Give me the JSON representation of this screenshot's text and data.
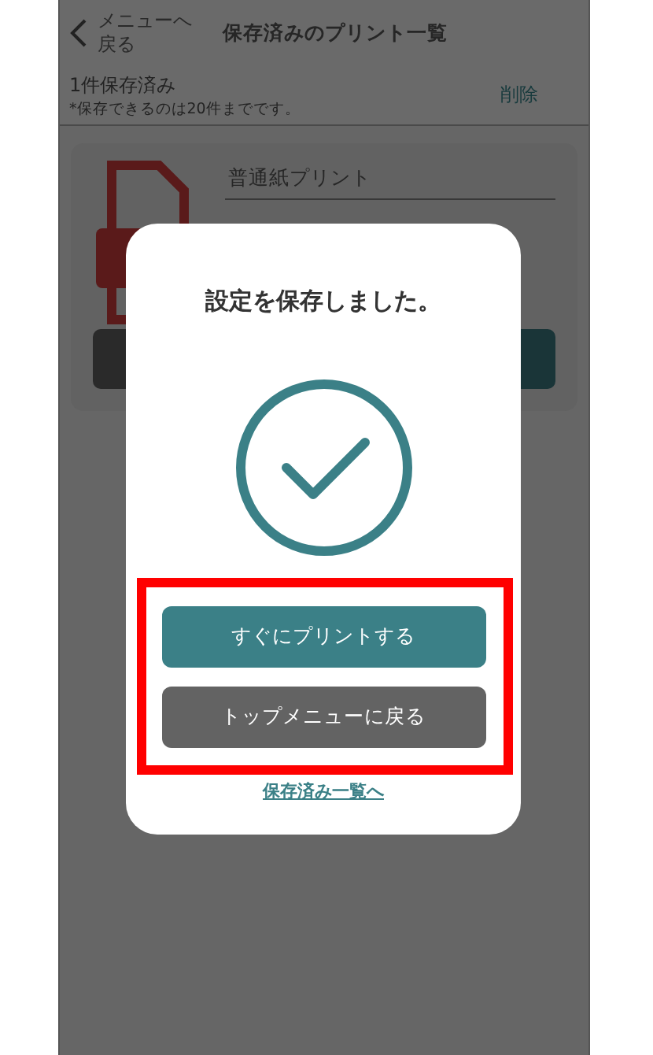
{
  "header": {
    "back_label": "メニューへ戻る",
    "title": "保存済みのプリント一覧"
  },
  "summary": {
    "count": "1件保存済み",
    "note": "*保存できるのは20件までです。",
    "delete_label": "削除"
  },
  "card": {
    "title": "普通紙プリント"
  },
  "dialog": {
    "message": "設定を保存しました。",
    "buttons": [
      {
        "label": "すぐにプリントする",
        "kind": "primary"
      },
      {
        "label": "トップメニューに戻る",
        "kind": "secondary"
      }
    ],
    "link": "保存済み一覧へ"
  }
}
